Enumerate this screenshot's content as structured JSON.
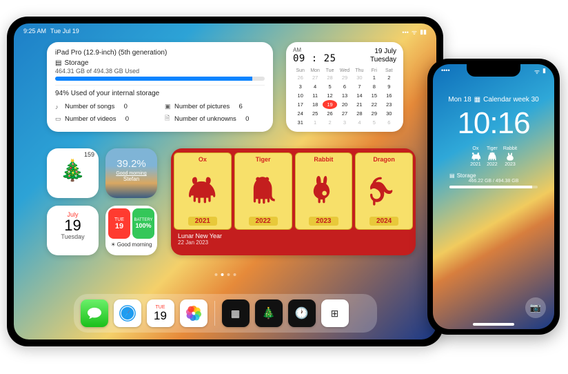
{
  "ipad": {
    "status_time": "9:25 AM",
    "status_date": "Tue Jul 19",
    "storage": {
      "device": "iPad Pro (12.9-inch) (5th generation)",
      "label": "Storage",
      "used_text": "464.31 GB of 494.38 GB Used",
      "pct_bar": 94,
      "pct_text": "94% Used of your internal storage",
      "songs_label": "Number of songs",
      "songs_val": "0",
      "pictures_label": "Number of pictures",
      "pictures_val": "6",
      "videos_label": "Number of videos",
      "videos_val": "0",
      "unknowns_label": "Number of unknowns",
      "unknowns_val": "0"
    },
    "calendar": {
      "ampm": "AM",
      "hh": "09",
      "mm": "25",
      "date_big": "19 July",
      "dow_big": "Tuesday",
      "dow": [
        "Sun",
        "Mon",
        "Tue",
        "Wed",
        "Thu",
        "Fri",
        "Sat"
      ],
      "days": [
        {
          "n": "26",
          "dim": true
        },
        {
          "n": "27",
          "dim": true
        },
        {
          "n": "28",
          "dim": true
        },
        {
          "n": "29",
          "dim": true
        },
        {
          "n": "30",
          "dim": true
        },
        {
          "n": "1"
        },
        {
          "n": "2"
        },
        {
          "n": "3"
        },
        {
          "n": "4"
        },
        {
          "n": "5"
        },
        {
          "n": "6"
        },
        {
          "n": "7"
        },
        {
          "n": "8"
        },
        {
          "n": "9"
        },
        {
          "n": "10"
        },
        {
          "n": "11"
        },
        {
          "n": "12"
        },
        {
          "n": "13"
        },
        {
          "n": "14"
        },
        {
          "n": "15"
        },
        {
          "n": "16"
        },
        {
          "n": "17"
        },
        {
          "n": "18"
        },
        {
          "n": "19",
          "today": true
        },
        {
          "n": "20"
        },
        {
          "n": "21"
        },
        {
          "n": "22"
        },
        {
          "n": "23"
        },
        {
          "n": "24"
        },
        {
          "n": "25"
        },
        {
          "n": "26"
        },
        {
          "n": "27"
        },
        {
          "n": "28"
        },
        {
          "n": "29"
        },
        {
          "n": "30"
        },
        {
          "n": "31"
        },
        {
          "n": "1",
          "dim": true
        },
        {
          "n": "2",
          "dim": true
        },
        {
          "n": "3",
          "dim": true
        },
        {
          "n": "4",
          "dim": true
        },
        {
          "n": "5",
          "dim": true
        },
        {
          "n": "6",
          "dim": true
        }
      ]
    },
    "tree_count": "159",
    "weather": {
      "pct": "39.2%",
      "greet": "Good morning",
      "name": "Stefan"
    },
    "date_sm": {
      "month": "July",
      "day": "19",
      "dow": "Tuesday"
    },
    "combo": {
      "sm_dow": "TUE",
      "sm_day": "19",
      "batt_label": "BATTERY",
      "batt_val": "100%",
      "greet": "Good morning"
    },
    "lunar": {
      "zodiac": [
        {
          "name": "Ox",
          "year": "2021"
        },
        {
          "name": "Tiger",
          "year": "2022"
        },
        {
          "name": "Rabbit",
          "year": "2023"
        },
        {
          "name": "Dragon",
          "year": "2024"
        }
      ],
      "title": "Lunar New Year",
      "date": "22 Jan 2023"
    },
    "dock_cal_dow": "TUE",
    "dock_cal_day": "19"
  },
  "iphone": {
    "line1_date": "Mon 18",
    "line1_extra": "Calendar week 30",
    "time": "10:16",
    "zodiac": [
      {
        "name": "Ox",
        "year": "2021"
      },
      {
        "name": "Tiger",
        "year": "2022"
      },
      {
        "name": "Rabbit",
        "year": "2023"
      }
    ],
    "storage_label": "Storage",
    "storage_sub": "466.22 GB / 494.38 GB"
  }
}
